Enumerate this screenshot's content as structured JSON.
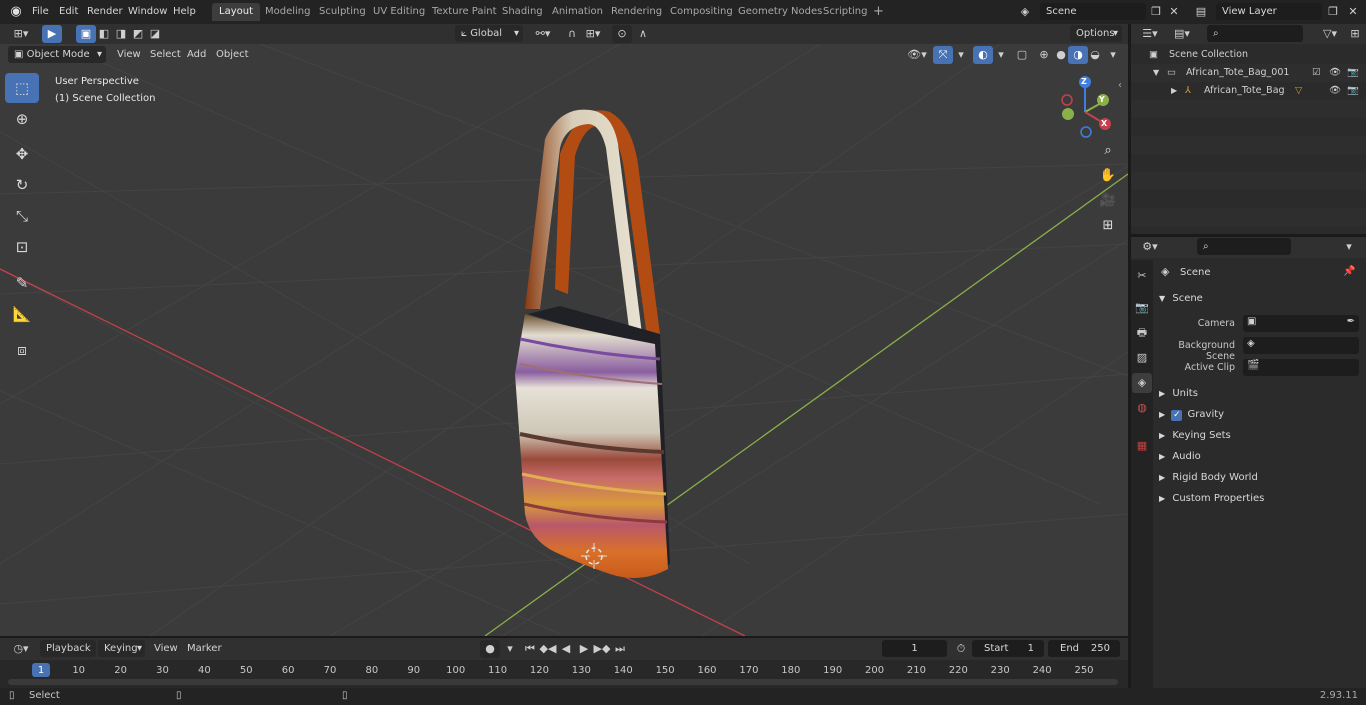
{
  "menu": {
    "items": [
      "File",
      "Edit",
      "Render",
      "Window",
      "Help"
    ]
  },
  "workspaces": {
    "tabs": [
      "Layout",
      "Modeling",
      "Sculpting",
      "UV Editing",
      "Texture Paint",
      "Shading",
      "Animation",
      "Rendering",
      "Compositing",
      "Geometry Nodes",
      "Scripting"
    ],
    "add_icon": "+"
  },
  "scene_selector": {
    "value": "Scene"
  },
  "view_layer": {
    "value": "View Layer"
  },
  "viewport": {
    "mode": "Object Mode",
    "menus": [
      "View",
      "Select",
      "Add",
      "Object"
    ],
    "transform_orientation": "Global",
    "options_label": "Options",
    "overlay_title": "User Perspective",
    "overlay_subtitle": "(1) Scene Collection",
    "gizmo_labels": [
      "Z",
      "Y",
      "X"
    ]
  },
  "outliner": {
    "root": "Scene Collection",
    "items": [
      {
        "label": "African_Tote_Bag_001"
      },
      {
        "label": "African_Tote_Bag"
      }
    ]
  },
  "properties": {
    "title": "Scene",
    "section": "Scene",
    "fields": [
      {
        "label": "Camera"
      },
      {
        "label": "Background Scene"
      },
      {
        "label": "Active Clip"
      }
    ],
    "panels": [
      "Units",
      "Gravity",
      "Keying Sets",
      "Audio",
      "Rigid Body World",
      "Custom Properties"
    ],
    "gravity_checked": true
  },
  "timeline": {
    "menus": [
      "Playback",
      "Keying",
      "View",
      "Marker"
    ],
    "current_frame": "1",
    "start_label": "Start",
    "start_value": "1",
    "end_label": "End",
    "end_value": "250",
    "ticks": [
      "1",
      "10",
      "20",
      "30",
      "40",
      "50",
      "60",
      "70",
      "80",
      "90",
      "100",
      "110",
      "120",
      "130",
      "140",
      "150",
      "160",
      "170",
      "180",
      "190",
      "200",
      "210",
      "220",
      "230",
      "240",
      "250"
    ]
  },
  "statusbar": {
    "left_label": "Select",
    "version": "2.93.11"
  },
  "colors": {
    "accent": "#4772b3",
    "x_axis": "#c4414c",
    "y_axis": "#8ab04a",
    "z_axis": "#3f7ee0"
  }
}
